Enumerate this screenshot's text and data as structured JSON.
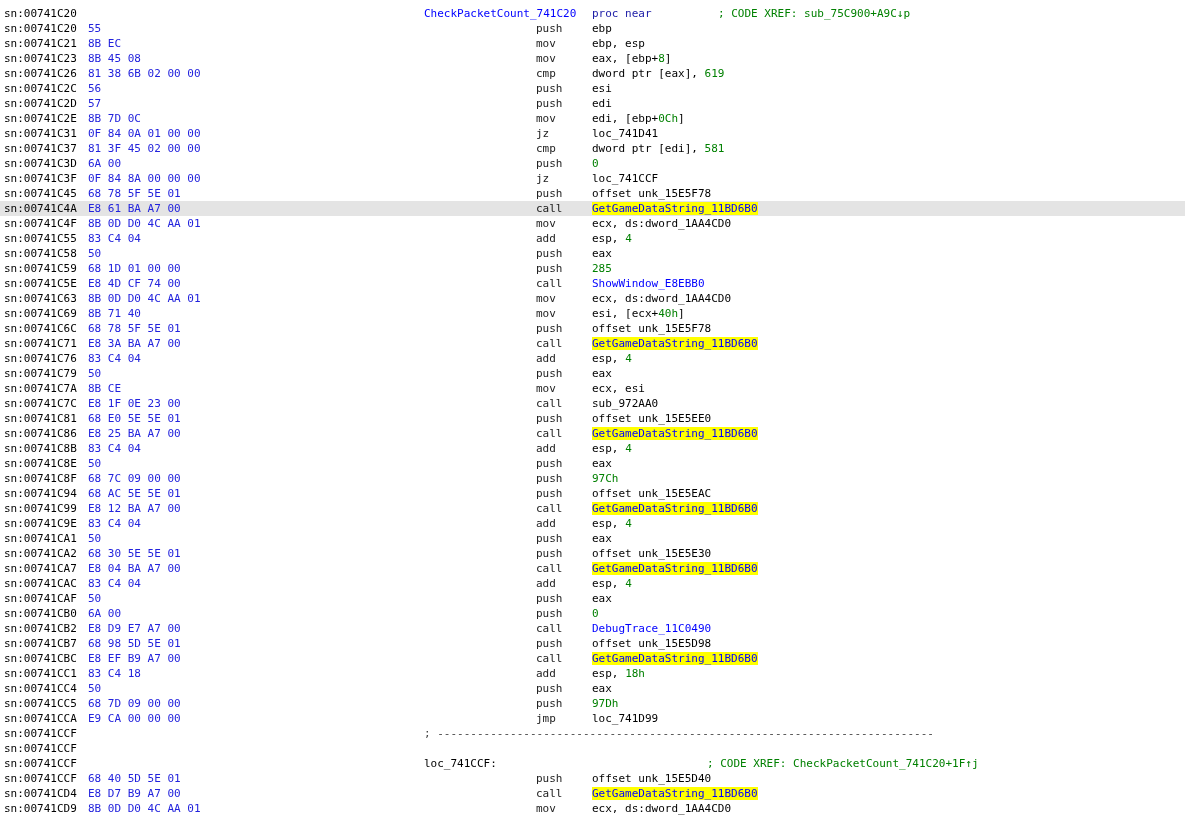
{
  "rows": [
    {
      "kind": "proc",
      "addr": "sn:00741C20",
      "label": "CheckPacketCount_741C20",
      "directive": "proc near",
      "comment": "; CODE XREF: sub_75C900+A9C↓p",
      "selected": false
    },
    {
      "kind": "instr",
      "addr": "sn:00741C20",
      "bytes": "55",
      "mnem": "push",
      "ops": [
        {
          "text": "ebp"
        }
      ],
      "selected": false
    },
    {
      "kind": "instr",
      "addr": "sn:00741C21",
      "bytes": "8B EC",
      "mnem": "mov",
      "ops": [
        {
          "text": "ebp, esp"
        }
      ],
      "selected": false
    },
    {
      "kind": "instr",
      "addr": "sn:00741C23",
      "bytes": "8B 45 08",
      "mnem": "mov",
      "ops": [
        {
          "text": "eax, [ebp+"
        },
        {
          "text": "8",
          "kind": "number"
        },
        {
          "text": "]"
        }
      ],
      "selected": false
    },
    {
      "kind": "instr",
      "addr": "sn:00741C26",
      "bytes": "81 38 6B 02 00 00",
      "mnem": "cmp",
      "ops": [
        {
          "text": "dword ptr [eax], "
        },
        {
          "text": "619",
          "kind": "number"
        }
      ],
      "selected": false
    },
    {
      "kind": "instr",
      "addr": "sn:00741C2C",
      "bytes": "56",
      "mnem": "push",
      "ops": [
        {
          "text": "esi"
        }
      ],
      "selected": false
    },
    {
      "kind": "instr",
      "addr": "sn:00741C2D",
      "bytes": "57",
      "mnem": "push",
      "ops": [
        {
          "text": "edi"
        }
      ],
      "selected": false
    },
    {
      "kind": "instr",
      "addr": "sn:00741C2E",
      "bytes": "8B 7D 0C",
      "mnem": "mov",
      "ops": [
        {
          "text": "edi, [ebp+"
        },
        {
          "text": "0Ch",
          "kind": "number"
        },
        {
          "text": "]"
        }
      ],
      "selected": false
    },
    {
      "kind": "instr",
      "addr": "sn:00741C31",
      "bytes": "0F 84 0A 01 00 00",
      "mnem": "jz",
      "ops": [
        {
          "text": "loc_741D41"
        }
      ],
      "selected": false
    },
    {
      "kind": "instr",
      "addr": "sn:00741C37",
      "bytes": "81 3F 45 02 00 00",
      "mnem": "cmp",
      "ops": [
        {
          "text": "dword ptr [edi], "
        },
        {
          "text": "581",
          "kind": "number"
        }
      ],
      "selected": false
    },
    {
      "kind": "instr",
      "addr": "sn:00741C3D",
      "bytes": "6A 00",
      "mnem": "push",
      "ops": [
        {
          "text": "0",
          "kind": "number"
        }
      ],
      "selected": false
    },
    {
      "kind": "instr",
      "addr": "sn:00741C3F",
      "bytes": "0F 84 8A 00 00 00",
      "mnem": "jz",
      "ops": [
        {
          "text": "loc_741CCF"
        }
      ],
      "selected": false
    },
    {
      "kind": "instr",
      "addr": "sn:00741C45",
      "bytes": "68 78 5F 5E 01",
      "mnem": "push",
      "ops": [
        {
          "text": "offset unk_15E5F78"
        }
      ],
      "selected": false
    },
    {
      "kind": "instr",
      "addr": "sn:00741C4A",
      "bytes": "E8 61 BA A7 00",
      "mnem": "call",
      "ops": [
        {
          "text": "GetGameDataString_11BD6B0",
          "kind": "highlighted"
        }
      ],
      "selected": true
    },
    {
      "kind": "instr",
      "addr": "sn:00741C4F",
      "bytes": "8B 0D D0 4C AA 01",
      "mnem": "mov",
      "ops": [
        {
          "text": "ecx, ds:dword_1AA4CD0"
        }
      ],
      "selected": false
    },
    {
      "kind": "instr",
      "addr": "sn:00741C55",
      "bytes": "83 C4 04",
      "mnem": "add",
      "ops": [
        {
          "text": "esp, "
        },
        {
          "text": "4",
          "kind": "number"
        }
      ],
      "selected": false
    },
    {
      "kind": "instr",
      "addr": "sn:00741C58",
      "bytes": "50",
      "mnem": "push",
      "ops": [
        {
          "text": "eax"
        }
      ],
      "selected": false
    },
    {
      "kind": "instr",
      "addr": "sn:00741C59",
      "bytes": "68 1D 01 00 00",
      "mnem": "push",
      "ops": [
        {
          "text": "285",
          "kind": "number"
        }
      ],
      "selected": false
    },
    {
      "kind": "instr",
      "addr": "sn:00741C5E",
      "bytes": "E8 4D CF 74 00",
      "mnem": "call",
      "ops": [
        {
          "text": "ShowWindow_E8EBB0",
          "kind": "function"
        }
      ],
      "selected": false
    },
    {
      "kind": "instr",
      "addr": "sn:00741C63",
      "bytes": "8B 0D D0 4C AA 01",
      "mnem": "mov",
      "ops": [
        {
          "text": "ecx, ds:dword_1AA4CD0"
        }
      ],
      "selected": false
    },
    {
      "kind": "instr",
      "addr": "sn:00741C69",
      "bytes": "8B 71 40",
      "mnem": "mov",
      "ops": [
        {
          "text": "esi, [ecx+"
        },
        {
          "text": "40h",
          "kind": "number"
        },
        {
          "text": "]"
        }
      ],
      "selected": false
    },
    {
      "kind": "instr",
      "addr": "sn:00741C6C",
      "bytes": "68 78 5F 5E 01",
      "mnem": "push",
      "ops": [
        {
          "text": "offset unk_15E5F78"
        }
      ],
      "selected": false
    },
    {
      "kind": "instr",
      "addr": "sn:00741C71",
      "bytes": "E8 3A BA A7 00",
      "mnem": "call",
      "ops": [
        {
          "text": "GetGameDataString_11BD6B0",
          "kind": "highlighted"
        }
      ],
      "selected": false
    },
    {
      "kind": "instr",
      "addr": "sn:00741C76",
      "bytes": "83 C4 04",
      "mnem": "add",
      "ops": [
        {
          "text": "esp, "
        },
        {
          "text": "4",
          "kind": "number"
        }
      ],
      "selected": false
    },
    {
      "kind": "instr",
      "addr": "sn:00741C79",
      "bytes": "50",
      "mnem": "push",
      "ops": [
        {
          "text": "eax"
        }
      ],
      "selected": false
    },
    {
      "kind": "instr",
      "addr": "sn:00741C7A",
      "bytes": "8B CE",
      "mnem": "mov",
      "ops": [
        {
          "text": "ecx, esi"
        }
      ],
      "selected": false
    },
    {
      "kind": "instr",
      "addr": "sn:00741C7C",
      "bytes": "E8 1F 0E 23 00",
      "mnem": "call",
      "ops": [
        {
          "text": "sub_972AA0"
        }
      ],
      "selected": false
    },
    {
      "kind": "instr",
      "addr": "sn:00741C81",
      "bytes": "68 E0 5E 5E 01",
      "mnem": "push",
      "ops": [
        {
          "text": "offset unk_15E5EE0"
        }
      ],
      "selected": false
    },
    {
      "kind": "instr",
      "addr": "sn:00741C86",
      "bytes": "E8 25 BA A7 00",
      "mnem": "call",
      "ops": [
        {
          "text": "GetGameDataString_11BD6B0",
          "kind": "highlighted"
        }
      ],
      "selected": false
    },
    {
      "kind": "instr",
      "addr": "sn:00741C8B",
      "bytes": "83 C4 04",
      "mnem": "add",
      "ops": [
        {
          "text": "esp, "
        },
        {
          "text": "4",
          "kind": "number"
        }
      ],
      "selected": false
    },
    {
      "kind": "instr",
      "addr": "sn:00741C8E",
      "bytes": "50",
      "mnem": "push",
      "ops": [
        {
          "text": "eax"
        }
      ],
      "selected": false
    },
    {
      "kind": "instr",
      "addr": "sn:00741C8F",
      "bytes": "68 7C 09 00 00",
      "mnem": "push",
      "ops": [
        {
          "text": "97Ch",
          "kind": "number"
        }
      ],
      "selected": false
    },
    {
      "kind": "instr",
      "addr": "sn:00741C94",
      "bytes": "68 AC 5E 5E 01",
      "mnem": "push",
      "ops": [
        {
          "text": "offset unk_15E5EAC"
        }
      ],
      "selected": false
    },
    {
      "kind": "instr",
      "addr": "sn:00741C99",
      "bytes": "E8 12 BA A7 00",
      "mnem": "call",
      "ops": [
        {
          "text": "GetGameDataString_11BD6B0",
          "kind": "highlighted"
        }
      ],
      "selected": false
    },
    {
      "kind": "instr",
      "addr": "sn:00741C9E",
      "bytes": "83 C4 04",
      "mnem": "add",
      "ops": [
        {
          "text": "esp, "
        },
        {
          "text": "4",
          "kind": "number"
        }
      ],
      "selected": false
    },
    {
      "kind": "instr",
      "addr": "sn:00741CA1",
      "bytes": "50",
      "mnem": "push",
      "ops": [
        {
          "text": "eax"
        }
      ],
      "selected": false
    },
    {
      "kind": "instr",
      "addr": "sn:00741CA2",
      "bytes": "68 30 5E 5E 01",
      "mnem": "push",
      "ops": [
        {
          "text": "offset unk_15E5E30"
        }
      ],
      "selected": false
    },
    {
      "kind": "instr",
      "addr": "sn:00741CA7",
      "bytes": "E8 04 BA A7 00",
      "mnem": "call",
      "ops": [
        {
          "text": "GetGameDataString_11BD6B0",
          "kind": "highlighted"
        }
      ],
      "selected": false
    },
    {
      "kind": "instr",
      "addr": "sn:00741CAC",
      "bytes": "83 C4 04",
      "mnem": "add",
      "ops": [
        {
          "text": "esp, "
        },
        {
          "text": "4",
          "kind": "number"
        }
      ],
      "selected": false
    },
    {
      "kind": "instr",
      "addr": "sn:00741CAF",
      "bytes": "50",
      "mnem": "push",
      "ops": [
        {
          "text": "eax"
        }
      ],
      "selected": false
    },
    {
      "kind": "instr",
      "addr": "sn:00741CB0",
      "bytes": "6A 00",
      "mnem": "push",
      "ops": [
        {
          "text": "0",
          "kind": "number"
        }
      ],
      "selected": false
    },
    {
      "kind": "instr",
      "addr": "sn:00741CB2",
      "bytes": "E8 D9 E7 A7 00",
      "mnem": "call",
      "ops": [
        {
          "text": "DebugTrace_11C0490",
          "kind": "function"
        }
      ],
      "selected": false
    },
    {
      "kind": "instr",
      "addr": "sn:00741CB7",
      "bytes": "68 98 5D 5E 01",
      "mnem": "push",
      "ops": [
        {
          "text": "offset unk_15E5D98"
        }
      ],
      "selected": false
    },
    {
      "kind": "instr",
      "addr": "sn:00741CBC",
      "bytes": "E8 EF B9 A7 00",
      "mnem": "call",
      "ops": [
        {
          "text": "GetGameDataString_11BD6B0",
          "kind": "highlighted"
        }
      ],
      "selected": false
    },
    {
      "kind": "instr",
      "addr": "sn:00741CC1",
      "bytes": "83 C4 18",
      "mnem": "add",
      "ops": [
        {
          "text": "esp, "
        },
        {
          "text": "18h",
          "kind": "number"
        }
      ],
      "selected": false
    },
    {
      "kind": "instr",
      "addr": "sn:00741CC4",
      "bytes": "50",
      "mnem": "push",
      "ops": [
        {
          "text": "eax"
        }
      ],
      "selected": false
    },
    {
      "kind": "instr",
      "addr": "sn:00741CC5",
      "bytes": "68 7D 09 00 00",
      "mnem": "push",
      "ops": [
        {
          "text": "97Dh",
          "kind": "number"
        }
      ],
      "selected": false
    },
    {
      "kind": "instr",
      "addr": "sn:00741CCA",
      "bytes": "E9 CA 00 00 00",
      "mnem": "jmp",
      "ops": [
        {
          "text": "loc_741D99"
        }
      ],
      "selected": false
    },
    {
      "kind": "separator",
      "addr": "sn:00741CCF",
      "text": "; ---------------------------------------------------------------------------",
      "selected": false
    },
    {
      "kind": "blank",
      "addr": "sn:00741CCF",
      "selected": false
    },
    {
      "kind": "loc",
      "addr": "sn:00741CCF",
      "label": "loc_741CCF:",
      "comment": "; CODE XREF: CheckPacketCount_741C20+1F↑j",
      "selected": false
    },
    {
      "kind": "instr",
      "addr": "sn:00741CCF",
      "bytes": "68 40 5D 5E 01",
      "mnem": "push",
      "ops": [
        {
          "text": "offset unk_15E5D40"
        }
      ],
      "selected": false
    },
    {
      "kind": "instr",
      "addr": "sn:00741CD4",
      "bytes": "E8 D7 B9 A7 00",
      "mnem": "call",
      "ops": [
        {
          "text": "GetGameDataString_11BD6B0",
          "kind": "highlighted"
        }
      ],
      "selected": false
    },
    {
      "kind": "instr",
      "addr": "sn:00741CD9",
      "bytes": "8B 0D D0 4C AA 01",
      "mnem": "mov",
      "ops": [
        {
          "text": "ecx, ds:dword_1AA4CD0"
        }
      ],
      "selected": false
    }
  ]
}
